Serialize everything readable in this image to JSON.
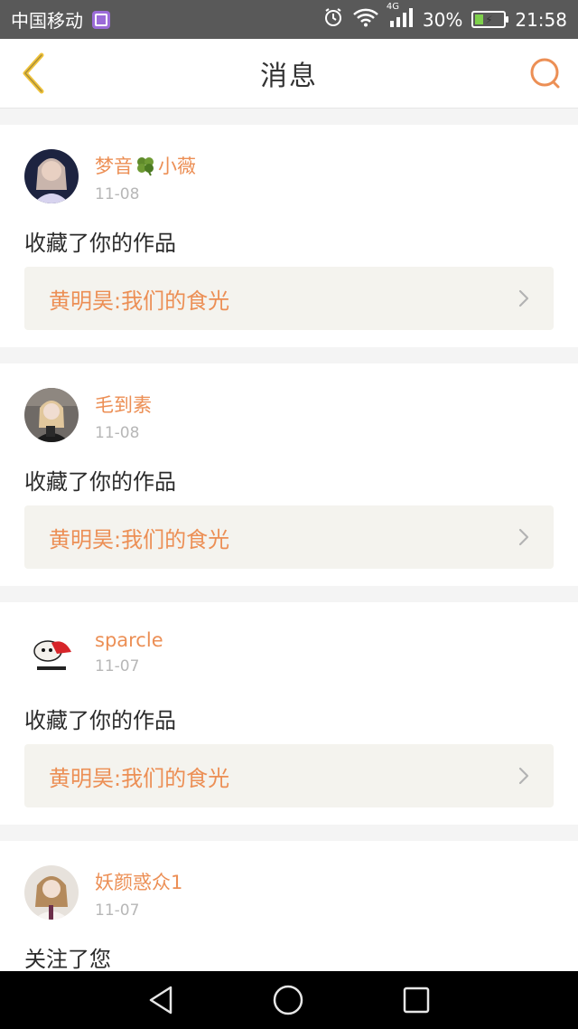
{
  "status_bar": {
    "carrier": "中国移动",
    "network": "4G",
    "battery_percent": "30%",
    "battery_level": 0.3,
    "time": "21:58"
  },
  "header": {
    "title": "消息",
    "back_icon": "chevron-left-icon",
    "search_icon": "search-icon"
  },
  "colors": {
    "accent": "#ec8f55",
    "back_arrow": "#f0c33a",
    "card_link_bg": "#f4f3ee"
  },
  "messages": [
    {
      "username_part1": "梦音",
      "username_emoji": "clover-icon",
      "username_part2": "小薇",
      "date": "11-08",
      "action": "收藏了你的作品",
      "work": "黄明昊:我们的食光"
    },
    {
      "username": "毛到素",
      "date": "11-08",
      "action": "收藏了你的作品",
      "work": "黄明昊:我们的食光"
    },
    {
      "username": "sparcle",
      "date": "11-07",
      "action": "收藏了你的作品",
      "work": "黄明昊:我们的食光"
    },
    {
      "username": "妖颜惑众1",
      "date": "11-07",
      "action": "关注了您"
    }
  ],
  "nav_bar": {
    "back": "triangle-back-icon",
    "home": "circle-home-icon",
    "recents": "square-recents-icon"
  }
}
